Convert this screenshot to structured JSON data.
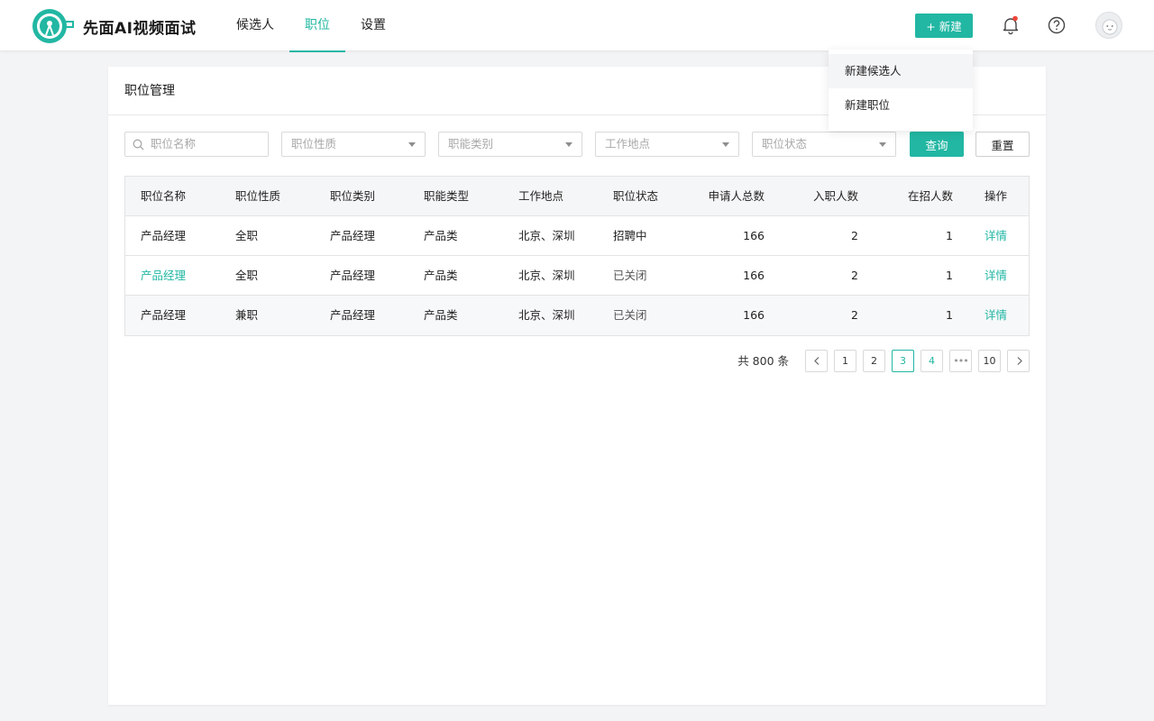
{
  "app": {
    "brand": "先面AI视频面试"
  },
  "nav": [
    {
      "label": "候选人"
    },
    {
      "label": "职位"
    },
    {
      "label": "设置"
    }
  ],
  "header": {
    "new_button": "+ 新建"
  },
  "dropdown": {
    "items": [
      "新建候选人",
      "新建职位"
    ]
  },
  "card": {
    "title": "职位管理"
  },
  "filters": {
    "search_placeholder": "职位名称",
    "selects": [
      "职位性质",
      "职能类别",
      "工作地点",
      "职位状态"
    ],
    "query": "查询",
    "reset": "重置"
  },
  "table": {
    "headers": [
      "职位名称",
      "职位性质",
      "职位类别",
      "职能类型",
      "工作地点",
      "职位状态",
      "申请人总数",
      "入职人数",
      "在招人数",
      "操作"
    ],
    "rows": [
      [
        "产品经理",
        "全职",
        "产品经理",
        "产品类",
        "北京、深圳",
        "招聘中",
        "166",
        "2",
        "1",
        "详情"
      ],
      [
        "产品经理",
        "全职",
        "产品经理",
        "产品类",
        "北京、深圳",
        "已关闭",
        "166",
        "2",
        "1",
        "详情"
      ],
      [
        "产品经理",
        "兼职",
        "产品经理",
        "产品类",
        "北京、深圳",
        "已关闭",
        "166",
        "2",
        "1",
        "详情"
      ]
    ]
  },
  "pagination": {
    "total": "共 800 条",
    "pages": [
      "1",
      "2",
      "3",
      "4",
      "•••",
      "10"
    ],
    "current": "3"
  },
  "colors": {
    "accent": "#22b7a3",
    "background": "#f3f4f6",
    "notification_dot": "#f0453a"
  }
}
